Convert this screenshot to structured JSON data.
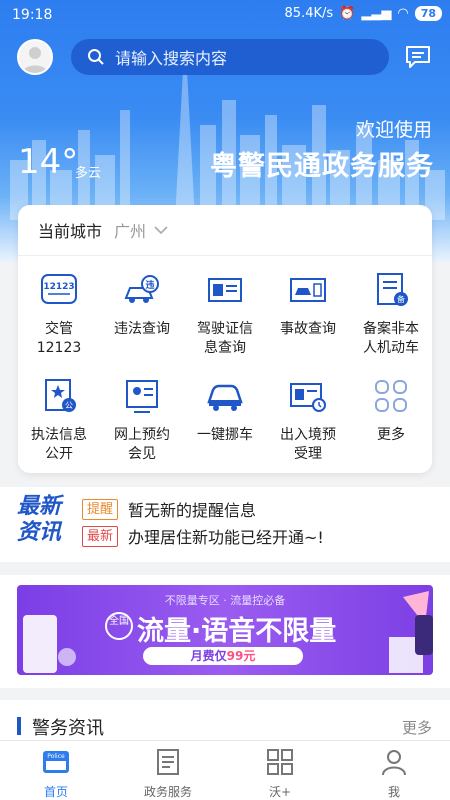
{
  "status_bar": {
    "time": "19:18",
    "speed": "85.4K/s",
    "battery": "78"
  },
  "header": {
    "search_placeholder": "请输入搜索内容"
  },
  "hero": {
    "temperature": "14°",
    "weather": "多云",
    "welcome": "欢迎使用",
    "brand": "粤警民通政务服务"
  },
  "city": {
    "label": "当前城市",
    "value": "广州"
  },
  "services": [
    {
      "label": "交管\n12123",
      "icon": "jiaoguan-12123-icon"
    },
    {
      "label": "违法查询",
      "icon": "violation-query-icon"
    },
    {
      "label": "驾驶证信\n息查询",
      "icon": "license-query-icon"
    },
    {
      "label": "事故查询",
      "icon": "accident-query-icon"
    },
    {
      "label": "备案非本\n人机动车",
      "icon": "vehicle-filing-icon"
    },
    {
      "label": "执法信息\n公开",
      "icon": "law-info-icon"
    },
    {
      "label": "网上预约\n会见",
      "icon": "appointment-icon"
    },
    {
      "label": "一键挪车",
      "icon": "move-car-icon"
    },
    {
      "label": "出入境预\n受理",
      "icon": "exit-entry-icon"
    },
    {
      "label": "更多",
      "icon": "more-grid-icon"
    }
  ],
  "news": {
    "logo": "最新\n资讯",
    "items": [
      {
        "tag": "提醒",
        "text": "暂无新的提醒信息"
      },
      {
        "tag": "最新",
        "text": "办理居住新功能已经开通~!"
      }
    ]
  },
  "banner": {
    "top": "不限量专区 · 流量控必备",
    "badge": "全国",
    "title": "流量·语音不限量",
    "price_prefix": "月费仅",
    "price": "99元"
  },
  "section": {
    "title": "警务资讯",
    "more": "更多"
  },
  "tabs": [
    {
      "label": "首页",
      "active": true
    },
    {
      "label": "政务服务",
      "active": false
    },
    {
      "label": "沃+",
      "active": false
    },
    {
      "label": "我",
      "active": false
    }
  ],
  "colors": {
    "primary": "#2d7df0",
    "brand_dark": "#1f57c9",
    "banner": "#8a4cec"
  }
}
